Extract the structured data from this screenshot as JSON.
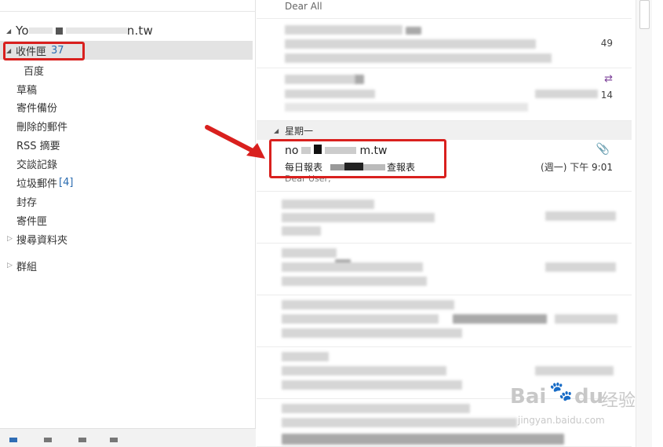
{
  "folder_pane": {
    "account": {
      "name_prefix": "Yo",
      "name_suffix": "n.tw"
    },
    "folders": [
      {
        "label": "收件匣",
        "count": "37"
      },
      {
        "label": "百度"
      },
      {
        "label": "草稿"
      },
      {
        "label": "寄件備份"
      },
      {
        "label": "刪除的郵件"
      },
      {
        "label": "RSS 摘要"
      },
      {
        "label": "交談記錄"
      },
      {
        "label": "垃圾郵件",
        "count": "[4]"
      },
      {
        "label": "封存"
      },
      {
        "label": "寄件匣"
      },
      {
        "label": "搜尋資料夾"
      }
    ],
    "groups_label": "群組"
  },
  "message_list": {
    "top_preview": "Dear All",
    "blurred_numbers": [
      "49",
      "14"
    ],
    "date_group": "星期一",
    "highlighted_message": {
      "sender_prefix": "no",
      "sender_suffix": "m.tw",
      "subject_prefix": "每日報表",
      "subject_suffix": "查報表",
      "received": "(週一) 下午 9:01",
      "preview": "Dear User,"
    }
  },
  "watermark": {
    "brand": "Bai",
    "brand_suffix": "du",
    "cn": "经验",
    "url": "jingyan.baidu.com"
  },
  "colors": {
    "highlight": "#d9201e",
    "accent_count": "#2b6cb0",
    "selected_bg": "#e3e3e3"
  }
}
